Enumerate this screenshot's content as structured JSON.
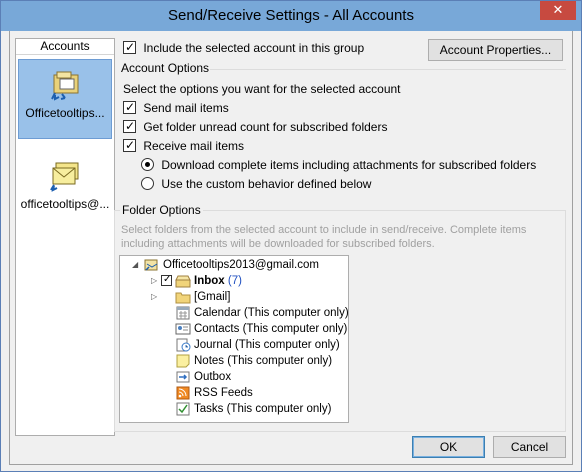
{
  "window": {
    "title": "Send/Receive Settings - All Accounts",
    "close_glyph": "✕"
  },
  "accounts": {
    "header": "Accounts",
    "items": [
      {
        "label": "Officetooltips..."
      },
      {
        "label": "officetooltips@..."
      }
    ]
  },
  "top": {
    "include_label": "Include the selected account in this group",
    "account_properties_label": "Account Properties..."
  },
  "account_options": {
    "title": "Account Options",
    "subtitle": "Select the options you want for the selected account",
    "send_mail": "Send mail items",
    "folder_unread": "Get folder unread count for subscribed folders",
    "receive_mail": "Receive mail items",
    "download_complete": "Download complete items including attachments for subscribed folders",
    "custom_behavior": "Use the custom behavior defined below"
  },
  "folder_options": {
    "title": "Folder Options",
    "desc_line1": "Select folders from the selected account to include in send/receive. Complete items",
    "desc_line2": "including attachments will be downloaded for subscribed folders.",
    "root": "Officetooltips2013@gmail.com",
    "inbox": "Inbox",
    "inbox_count": "(7)",
    "gmail": "[Gmail]",
    "calendar": "Calendar (This computer only)",
    "contacts": "Contacts (This computer only)",
    "journal": "Journal (This computer only)",
    "notes": "Notes (This computer only)",
    "outbox": "Outbox",
    "rss": "RSS Feeds",
    "tasks": "Tasks (This computer only)"
  },
  "footer": {
    "ok_label": "OK",
    "cancel_label": "Cancel"
  }
}
